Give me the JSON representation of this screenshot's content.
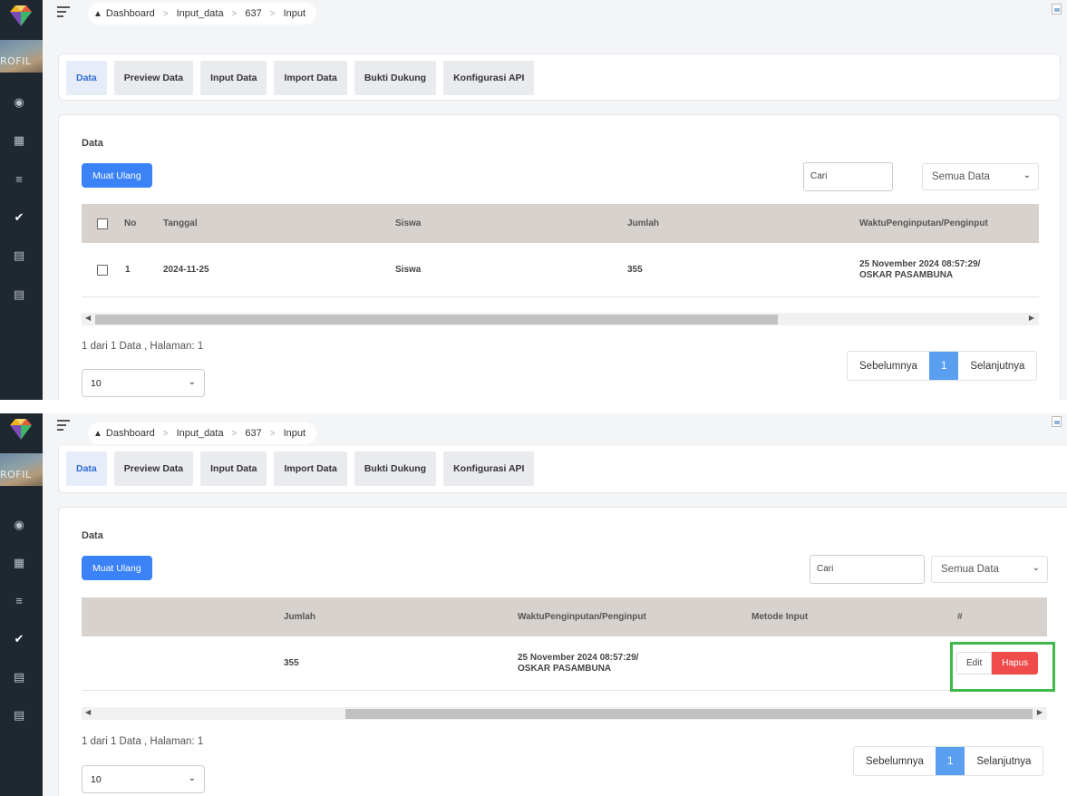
{
  "breadcrumb": [
    "Dashboard",
    "Input_data",
    "637",
    "Input"
  ],
  "sidebar": {
    "avatar_text": "ROFIL",
    "icons": [
      "home-icon",
      "grid-icon",
      "list-icon",
      "check-circle-icon",
      "document-icon",
      "document-icon"
    ]
  },
  "tabs": [
    "Data",
    "Preview Data",
    "Input Data",
    "Import Data",
    "Bukti Dukung",
    "Konfigurasi API"
  ],
  "card": {
    "title": "Data",
    "reload_label": "Muat Ulang",
    "search_placeholder": "Cari",
    "filter_selected": "Semua Data"
  },
  "table_top": {
    "columns": [
      "No",
      "Tanggal",
      "Siswa",
      "Jumlah",
      "WaktuPenginputan/Penginput"
    ],
    "row": {
      "no": "1",
      "tanggal": "2024-11-25",
      "siswa": "Siswa",
      "jumlah": "355",
      "waktu_line1": "25 November 2024 08:57:29/",
      "waktu_line2": "OSKAR PASAMBUNA"
    }
  },
  "table_bottom": {
    "columns": [
      "Jumlah",
      "WaktuPenginputan/Penginput",
      "Metode Input",
      "#"
    ],
    "row": {
      "jumlah": "355",
      "waktu_line1": "25 November 2024 08:57:29/",
      "waktu_line2": "OSKAR PASAMBUNA",
      "edit_label": "Edit",
      "delete_label": "Hapus"
    }
  },
  "footer": {
    "info": "1 dari 1 Data , Halaman: 1",
    "page_size": "10",
    "prev_label": "Sebelumnya",
    "current_page": "1",
    "next_label": "Selanjutnya"
  },
  "colors": {
    "sidebar": "#1f2731",
    "primary": "#3b82f6",
    "danger": "#ef4b4b",
    "highlight": "#3fb94a",
    "table_header": "#d7d2cd"
  }
}
